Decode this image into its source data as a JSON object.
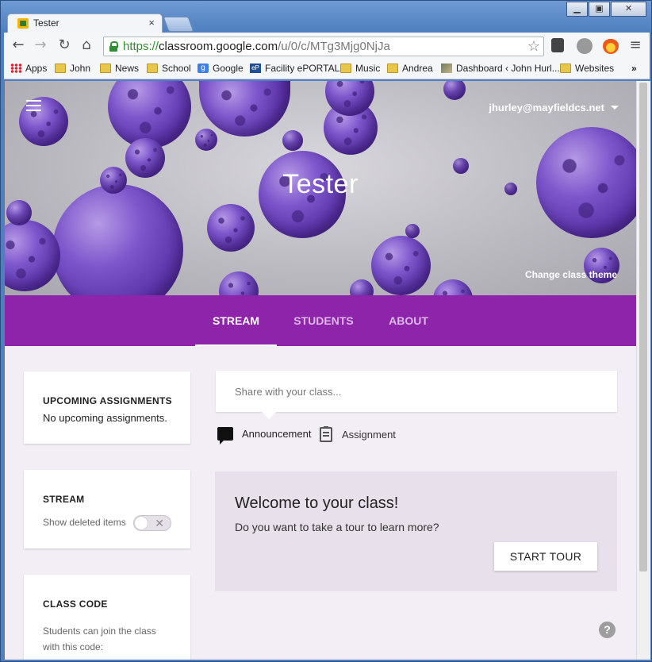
{
  "window": {
    "minimize_icon": "minimize-icon",
    "maximize_icon": "maximize-icon",
    "close_glyph": "✕"
  },
  "browser": {
    "tab_title": "Tester",
    "tab_close": "×",
    "url_scheme": "https://",
    "url_host": "classroom.google.com",
    "url_path": "/u/0/c/MTg3Mjg0NjJa"
  },
  "bookmarks": [
    {
      "label": "Apps",
      "icon": "apps-grid-icon"
    },
    {
      "label": "John",
      "icon": "folder-icon"
    },
    {
      "label": "News",
      "icon": "folder-icon"
    },
    {
      "label": "School",
      "icon": "folder-icon"
    },
    {
      "label": "Google",
      "icon": "google-icon"
    },
    {
      "label": "Facility ePORTAL",
      "icon": "eportal-icon"
    },
    {
      "label": "Music",
      "icon": "folder-icon"
    },
    {
      "label": "Andrea",
      "icon": "folder-icon"
    },
    {
      "label": "Dashboard ‹ John Hurl...",
      "icon": "user-photo-icon"
    },
    {
      "label": "Websites",
      "icon": "folder-icon"
    }
  ],
  "bookmarks_overflow": "»",
  "header": {
    "account": "jhurley@mayfieldcs.net",
    "class_name": "Tester",
    "change_theme": "Change class theme"
  },
  "tabs": [
    {
      "label": "STREAM",
      "active": true
    },
    {
      "label": "STUDENTS",
      "active": false
    },
    {
      "label": "ABOUT",
      "active": false
    }
  ],
  "sidebar": {
    "upcoming": {
      "title": "UPCOMING ASSIGNMENTS",
      "text": "No upcoming assignments."
    },
    "stream": {
      "title": "STREAM",
      "toggle_label": "Show deleted items",
      "toggle_on": false
    },
    "class_code": {
      "title": "CLASS CODE",
      "text": "Students can join the class with this code:"
    }
  },
  "composer": {
    "placeholder": "Share with your class...",
    "announcement": "Announcement",
    "assignment": "Assignment"
  },
  "welcome": {
    "title": "Welcome to your class!",
    "text": "Do you want to take a tour to learn more?",
    "button": "START TOUR"
  },
  "help": "?",
  "colors": {
    "class_theme": "#8e24aa",
    "page_bg": "#f3edf5",
    "sphere": "#7d56cc"
  }
}
